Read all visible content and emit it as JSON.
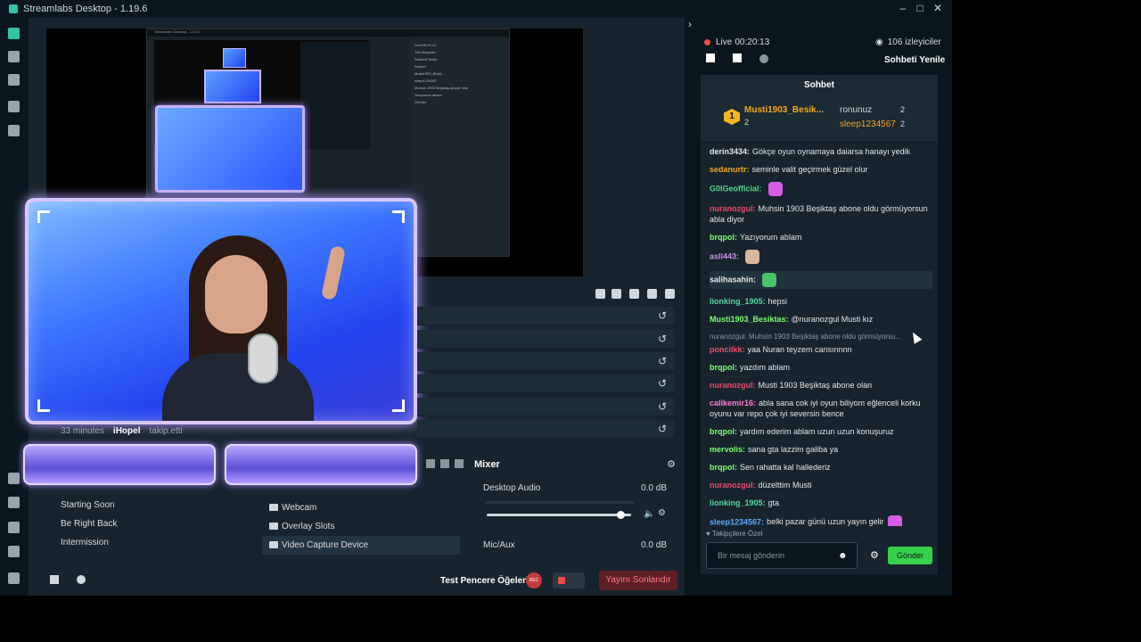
{
  "window": {
    "title": "Streamlabs Desktop - 1.19.6"
  },
  "mini": {
    "title": "Streamlabs Desktop - 1.19.6",
    "chat_lines": [
      "LiveOB:20:13",
      "106 izleyiciler",
      "Sohbeti Yenile",
      "Sohbet",
      "Musti1903_Besik...",
      "sleep1234567",
      "Muhsin 1903 Beşiktaş abone oldu",
      "Yazıyorum ablam",
      "Gönder"
    ]
  },
  "preview": {
    "follow_time": "33 minutes",
    "follow_user": "iHopel",
    "follow_action": "takip.etti"
  },
  "scenes": [
    "Starting Soon",
    "Be Right Back",
    "Intermission"
  ],
  "sources": [
    {
      "label": "Webcam",
      "selected": false
    },
    {
      "label": "Overlay Slots",
      "selected": false
    },
    {
      "label": "Video Capture Device",
      "selected": true
    }
  ],
  "mixer": {
    "title": "Mixer",
    "tracks": [
      {
        "label": "Desktop Audio",
        "db": "0.0 dB",
        "level": 0.95
      },
      {
        "label": "Mic/Aux",
        "db": "0.0 dB",
        "level": 0.0
      }
    ]
  },
  "footer": {
    "test_label": "Test Pencere Öğeleri",
    "rec_label": "REC",
    "end_label": "Yayını Sonlandır"
  },
  "stream": {
    "live_label": "Live",
    "time": "00:20:13",
    "viewers": "106 izleyiciler",
    "refresh": "Sohbeti Yenile"
  },
  "chat": {
    "title": "Sohbet",
    "leader": {
      "rank": "1",
      "top_name": "Musti1903_Besik...",
      "top_count": "2",
      "second_name": "ronunuz",
      "second_count": "2",
      "third_name": "sleep1234567",
      "third_count": "2"
    },
    "messages": [
      {
        "name": "derin3434:",
        "color": "#e7e7e7",
        "text": "Gökçe oyun oynamaya daiarsa hanayı yedik"
      },
      {
        "name": "sedanurtr:",
        "color": "#f5a623",
        "text": "seminle valit geçirmek güzel olur"
      },
      {
        "name": "G0IGeofficial:",
        "color": "#4fd38b",
        "text": "",
        "emote": "#d65de6"
      },
      {
        "name": "nuranozgul:",
        "color": "#ea4b6a",
        "text": "Muhsin 1903 Beşiktaş abone oldu görmüyorsun abla diyor"
      },
      {
        "name": "brqpol:",
        "color": "#7cff6b",
        "text": "Yazıyorum ablam"
      },
      {
        "name": "asli443:",
        "color": "#c792ea",
        "text": "",
        "emote": "#d7b89c"
      },
      {
        "name": "salihasahin:",
        "color": "#e7e7e7",
        "text": "",
        "emote": "#49c46a",
        "hl": true
      },
      {
        "name": "lionking_1905:",
        "color": "#52d6a2",
        "text": "hepsi"
      },
      {
        "name": "Musti1903_Besiktas:",
        "color": "#7cff6b",
        "text": "@nuranozgul Musti kız"
      },
      {
        "name": "poncilkk:",
        "color": "#ea4b6a",
        "text": "yaa Nuran teyzem cansınnnn",
        "reply": "nuranozgul: Muhsin 1903 Beşiktaş abone oldu görmüyorsu..."
      },
      {
        "name": "brqpol:",
        "color": "#7cff6b",
        "text": "yazdım ablam"
      },
      {
        "name": "nuranozgul:",
        "color": "#ea4b6a",
        "text": "Musti 1903 Beşiktaş abone olan"
      },
      {
        "name": "calikemir16:",
        "color": "#ff7bd0",
        "text": "abla sana cok iyi oyun biliyom eğlenceli korku oyunu var repo çok iyi seversin bence"
      },
      {
        "name": "brqpol:",
        "color": "#7cff6b",
        "text": "yardım ederim ablam uzun uzun konuşuruz"
      },
      {
        "name": "mervolis:",
        "color": "#7cff6b",
        "text": "sana gta lazzim galiba ya"
      },
      {
        "name": "brqpol:",
        "color": "#7cff6b",
        "text": "Sen rahatta kal hallederiz"
      },
      {
        "name": "nuranozgul:",
        "color": "#ea4b6a",
        "text": "düzelttim Musti"
      },
      {
        "name": "lionking_1905:",
        "color": "#52d6a2",
        "text": "gta"
      },
      {
        "name": "sleep1234567:",
        "color": "#5aa9ff",
        "text": "belki pazar günü uzun yayın gelir",
        "emote": "#d65de6"
      }
    ],
    "follower_only": "Takipçilere Özel",
    "input_placeholder": "Bir mesaj gönderin",
    "send_label": "Gönder"
  }
}
